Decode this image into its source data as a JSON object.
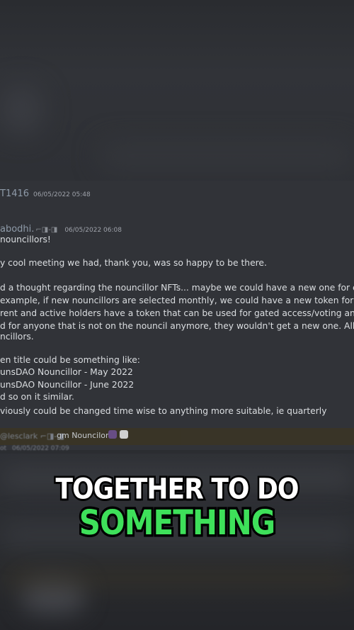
{
  "messages": [
    {
      "user": "T1416",
      "time": "06/05/2022 05:48"
    },
    {
      "user": "abodhi.",
      "badges": "⌐◨-◨",
      "time": "06/05/2022 06:08",
      "lines": [
        "nouncillors!",
        "",
        "y cool meeting we had, thank you, was so happy to be there.",
        "",
        "d a thought regarding the nouncillor NFTs... maybe we could have a new one for each period of",
        "example, if new nouncillors are selected monthly, we could have a new token for each month. T",
        "rent and active holders have a token that can be used for gated access/voting and any thing els",
        "d for anyone that is not on the nouncil anymore, they wouldn't get a new one. All older ones are",
        "ncillors.",
        "",
        "en title could be something like:",
        "unsDAO Nouncillor - May 2022",
        "unsDAO Nouncillor - June 2022",
        "d so on it similar.",
        "viously could be changed time wise to anything more suitable, ie quarterly"
      ]
    }
  ],
  "reply": {
    "user": "@lesclark",
    "badges": "⌐◨-◨",
    "text": "gm Nouncilors"
  },
  "faded_row": {
    "user": "ot",
    "time": "06/05/2022 07:09"
  },
  "caption": {
    "line1": "TOGETHER TO DO",
    "line2": "SOMETHING"
  },
  "colors": {
    "chat_bg": "#313338",
    "text": "#dbdee1",
    "caption_highlight": "#3ee05a"
  }
}
